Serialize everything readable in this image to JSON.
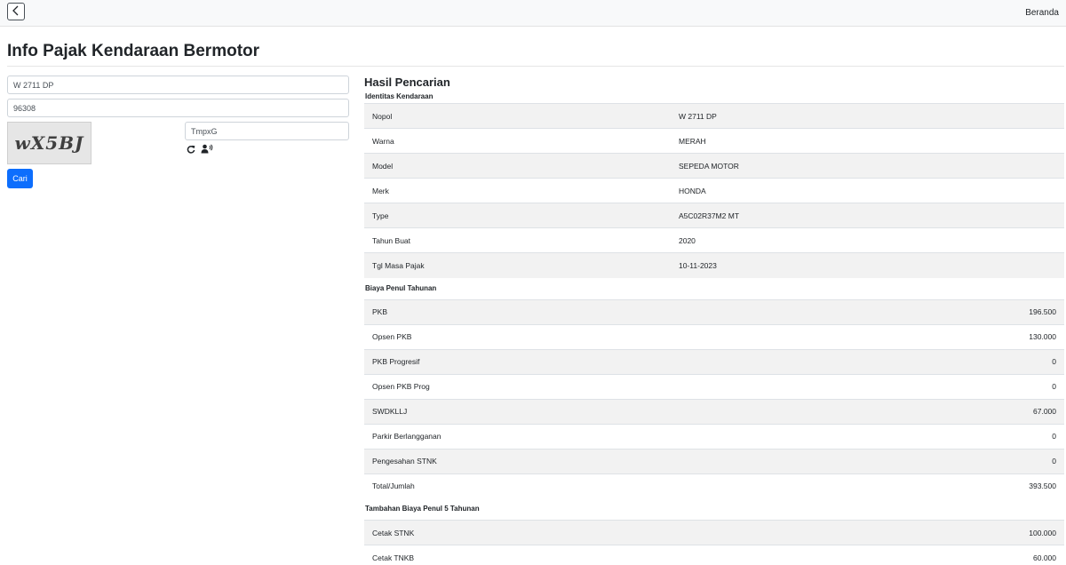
{
  "topbar": {
    "back_icon": "chevron-left-icon",
    "home_label": "Beranda"
  },
  "page": {
    "title": "Info Pajak Kendaraan Bermotor"
  },
  "form": {
    "nopol_value": "W 2711 DP",
    "code_value": "96308",
    "captcha_image_text": "wX5BJ",
    "captcha_input_value": "TmpxG",
    "refresh_icon": "refresh-icon",
    "audio_icon": "speaker-person-icon",
    "submit_label": "Cari",
    "submit_color": "#0d6efd"
  },
  "results": {
    "heading": "Hasil Pencarian",
    "identity": {
      "label": "Identitas Kendaraan",
      "rows": [
        {
          "key": "Nopol",
          "value": "W 2711 DP"
        },
        {
          "key": "Warna",
          "value": "MERAH"
        },
        {
          "key": "Model",
          "value": "SEPEDA MOTOR"
        },
        {
          "key": "Merk",
          "value": "HONDA"
        },
        {
          "key": "Type",
          "value": "A5C02R37M2 MT"
        },
        {
          "key": "Tahun Buat",
          "value": "2020"
        },
        {
          "key": "Tgl Masa Pajak",
          "value": "10-11-2023"
        }
      ]
    },
    "annual": {
      "label": "Biaya Penul Tahunan",
      "rows": [
        {
          "key": "PKB",
          "value": "196.500"
        },
        {
          "key": "Opsen PKB",
          "value": "130.000"
        },
        {
          "key": "PKB Progresif",
          "value": "0"
        },
        {
          "key": "Opsen PKB Prog",
          "value": "0"
        },
        {
          "key": "SWDKLLJ",
          "value": "67.000"
        },
        {
          "key": "Parkir Berlangganan",
          "value": "0"
        },
        {
          "key": "Pengesahan STNK",
          "value": "0"
        },
        {
          "key": "Total/Jumlah",
          "value": "393.500"
        }
      ]
    },
    "five_year": {
      "label": "Tambahan Biaya Penul 5 Tahunan",
      "rows": [
        {
          "key": "Cetak STNK",
          "value": "100.000"
        },
        {
          "key": "Cetak TNKB",
          "value": "60.000"
        }
      ]
    }
  }
}
